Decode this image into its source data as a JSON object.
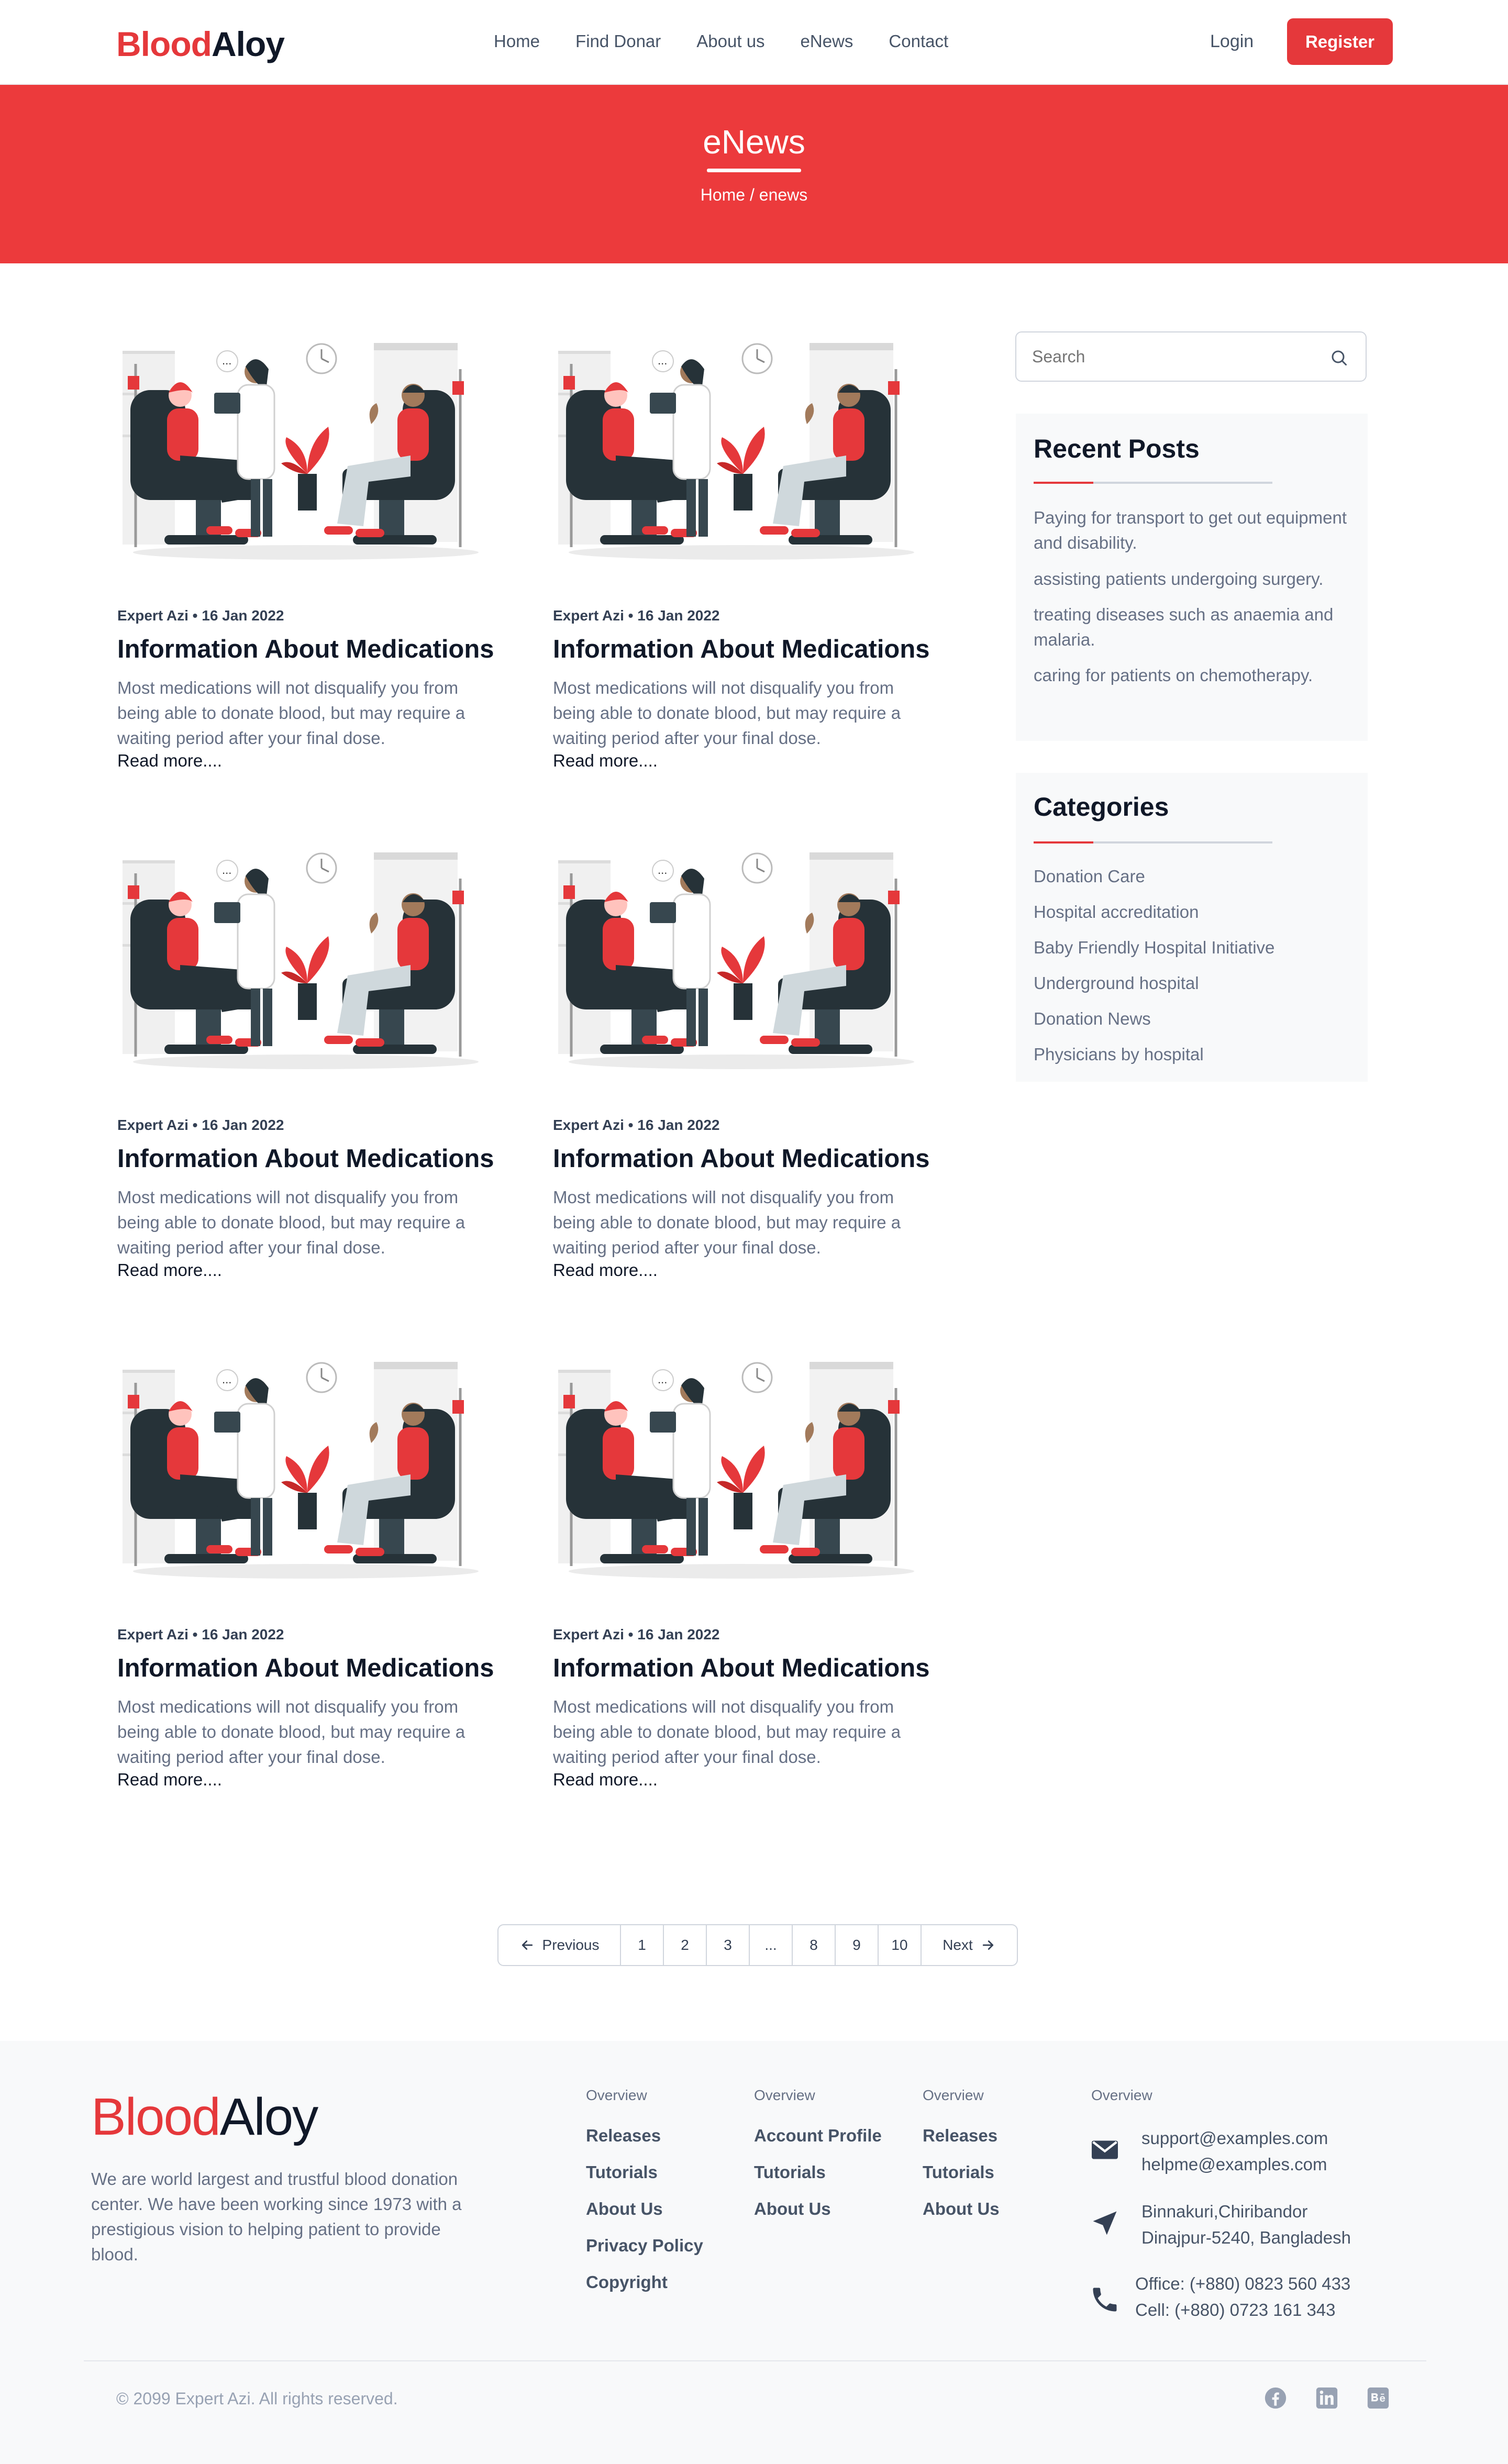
{
  "header": {
    "logo": {
      "part1": "Blood",
      "part2": "Aloy"
    },
    "nav": [
      "Home",
      "Find Donar",
      "About us",
      "eNews",
      "Contact"
    ],
    "login": "Login",
    "register": "Register"
  },
  "banner": {
    "title": "eNews",
    "breadcrumb": "Home / enews"
  },
  "posts": [
    {
      "meta": "Expert Azi • 16 Jan 2022",
      "title": "Information About Medications",
      "excerpt": "Most medications will not disqualify you from being able to donate blood, but may require a waiting period after your final dose.",
      "read_more": "Read more...."
    },
    {
      "meta": "Expert Azi • 16 Jan 2022",
      "title": "Information About Medications",
      "excerpt": "Most medications will not disqualify you from being able to donate blood, but may require a waiting period after your final dose.",
      "read_more": "Read more...."
    },
    {
      "meta": "Expert Azi • 16 Jan 2022",
      "title": "Information About Medications",
      "excerpt": "Most medications will not disqualify you from being able to donate blood, but may require a waiting period after your final dose.",
      "read_more": "Read more...."
    },
    {
      "meta": "Expert Azi • 16 Jan 2022",
      "title": "Information About Medications",
      "excerpt": "Most medications will not disqualify you from being able to donate blood, but may require a waiting period after your final dose.",
      "read_more": "Read more...."
    },
    {
      "meta": "Expert Azi • 16 Jan 2022",
      "title": "Information About Medications",
      "excerpt": "Most medications will not disqualify you from being able to donate blood, but may require a waiting period after your final dose.",
      "read_more": "Read more...."
    },
    {
      "meta": "Expert Azi • 16 Jan 2022",
      "title": "Information About Medications",
      "excerpt": "Most medications will not disqualify you from being able to donate blood, but may require a waiting period after your final dose.",
      "read_more": "Read more...."
    }
  ],
  "sidebar": {
    "search_placeholder": "Search",
    "recent_posts": {
      "title": "Recent Posts",
      "items": [
        "Paying for transport to get out equipment and disability.",
        "assisting patients undergoing surgery.",
        "treating diseases such as anaemia and malaria.",
        "caring for patients on chemotherapy."
      ]
    },
    "categories": {
      "title": "Categories",
      "items": [
        "Donation Care",
        "Hospital accreditation",
        "Baby Friendly Hospital Initiative",
        "Underground hospital",
        "Donation News",
        "Physicians by hospital"
      ]
    }
  },
  "pagination": {
    "previous": "Previous",
    "pages": [
      "1",
      "2",
      "3",
      "...",
      "8",
      "9",
      "10"
    ],
    "next": "Next"
  },
  "footer": {
    "logo": {
      "part1": "Blood",
      "part2": "Aloy"
    },
    "description": "We are world largest and trustful blood donation center. We have been working since 1973 with a prestigious vision to helping patient to provide blood.",
    "columns": [
      {
        "heading": "Overview",
        "links": [
          "Releases",
          "Tutorials",
          "About Us",
          "Privacy Policy",
          "Copyright"
        ]
      },
      {
        "heading": "Overview",
        "links": [
          "Account Profile",
          "Tutorials",
          "About Us"
        ]
      },
      {
        "heading": "Overview",
        "links": [
          "Releases",
          "Tutorials",
          "About Us"
        ]
      }
    ],
    "contact": {
      "heading": "Overview",
      "email1": "support@examples.com",
      "email2": "helpme@examples.com",
      "address1": "Binnakuri,Chiribandor",
      "address2": "Dinajpur-5240, Bangladesh",
      "phone1": "Office: (+880) 0823 560 433",
      "phone2": "Cell: (+880) 0723 161 343"
    },
    "copyright": "© 2099 Expert Azi. All rights reserved.",
    "social_icons": [
      "facebook-icon",
      "linkedin-icon",
      "behance-icon"
    ]
  },
  "colors": {
    "brand_red": "#e5383b",
    "banner_red": "#ec3a3c",
    "text_dark": "#101828",
    "text_muted": "#667085"
  }
}
